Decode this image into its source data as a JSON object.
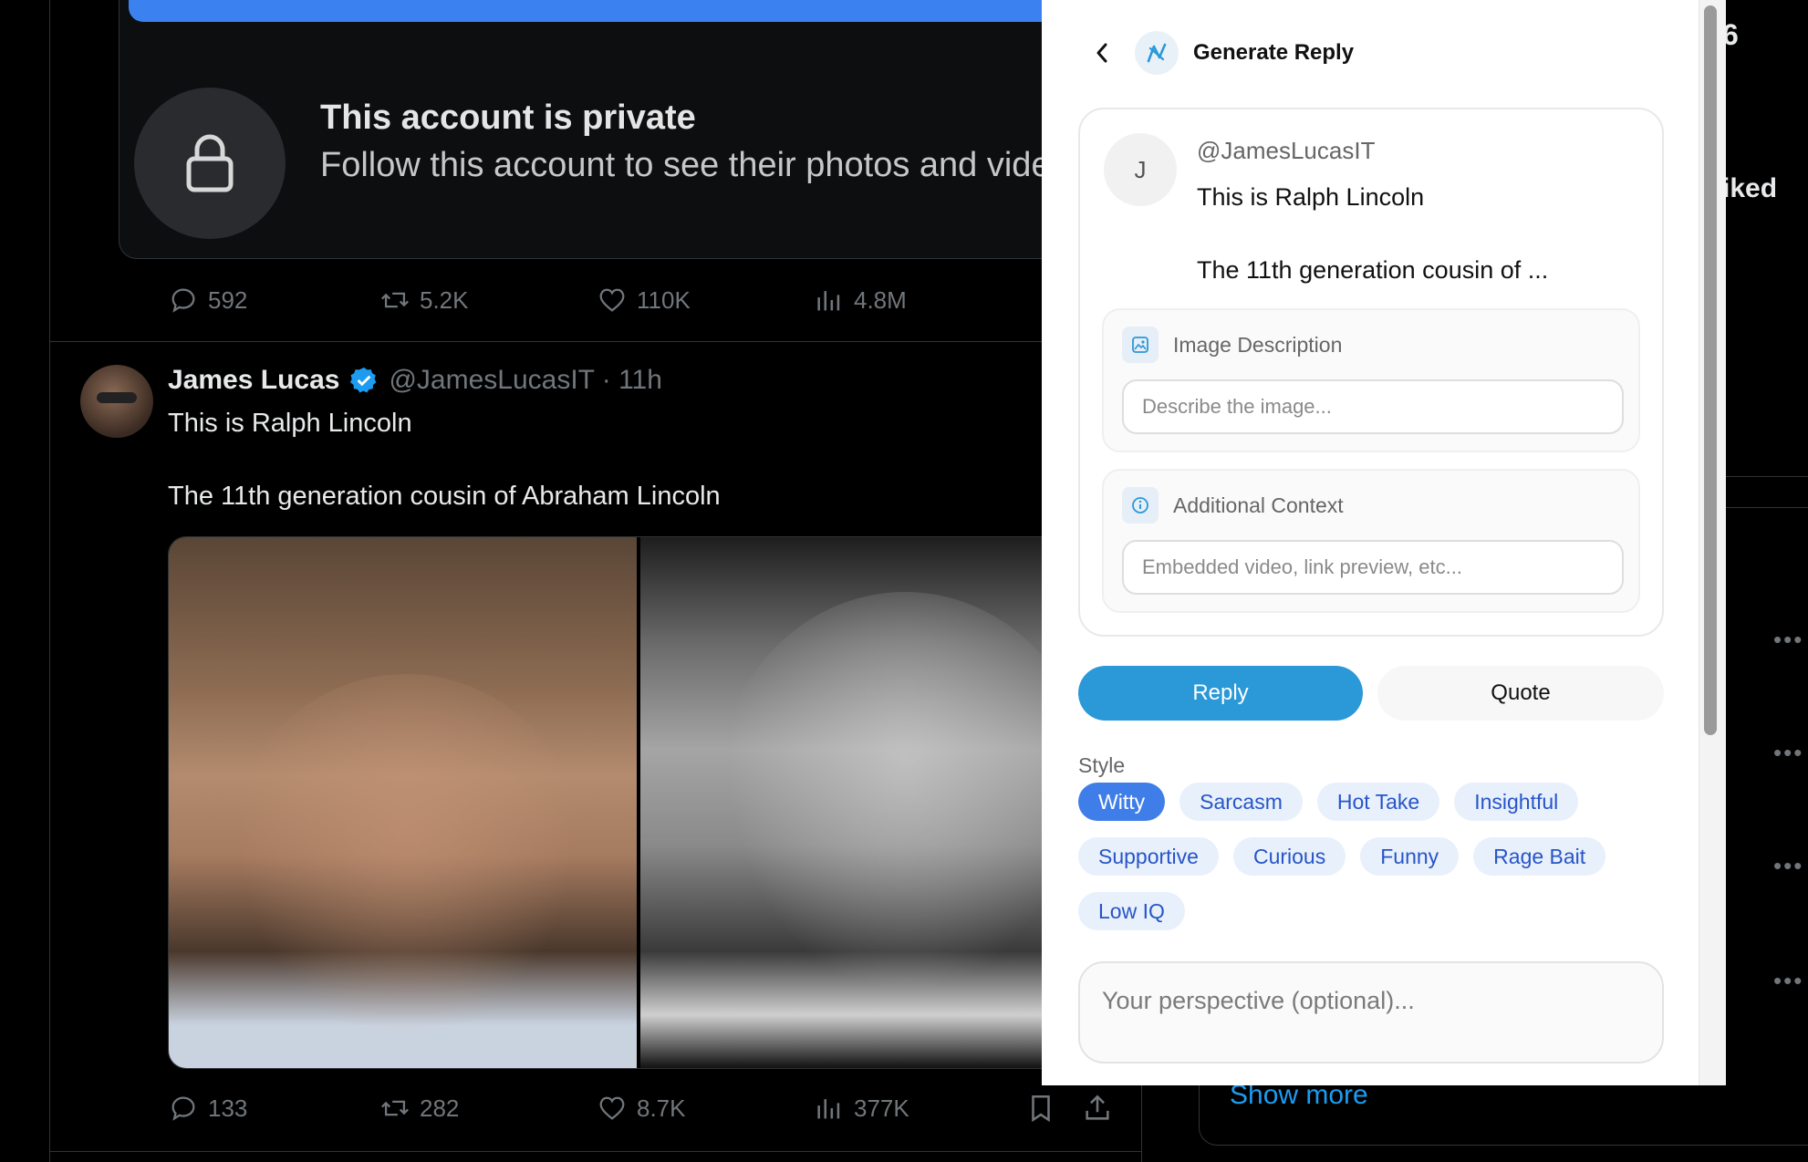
{
  "feed": {
    "private_card": {
      "title": "This account is private",
      "subtitle": "Follow this account to see their photos and videos."
    },
    "tweet1_actions": {
      "replies": "592",
      "retweets": "5.2K",
      "likes": "110K",
      "views": "4.8M"
    },
    "tweet2": {
      "author_name": "James Lucas",
      "author_handle": "@JamesLucasIT · 11h",
      "line1": "This is Ralph Lincoln",
      "line2": "The 11th generation cousin of Abraham Lincoln",
      "actions": {
        "replies": "133",
        "retweets": "282",
        "likes": "8.7K",
        "views": "377K"
      }
    }
  },
  "right_column": {
    "trend_fragment": "6",
    "liked_fragment": "iked",
    "show_more": "Show more"
  },
  "panel": {
    "title": "Generate Reply",
    "tweet_preview": {
      "avatar_letter": "J",
      "handle": "@JamesLucasIT",
      "line1": "This is Ralph Lincoln",
      "line2": "The 11th generation cousin of ..."
    },
    "image_description": {
      "label": "Image Description",
      "placeholder": "Describe the image...",
      "value": ""
    },
    "additional_context": {
      "label": "Additional Context",
      "placeholder": "Embedded video, link preview, etc...",
      "value": ""
    },
    "modes": {
      "reply": "Reply",
      "quote": "Quote",
      "selected": "Reply"
    },
    "style_label": "Style",
    "styles": [
      "Witty",
      "Sarcasm",
      "Hot Take",
      "Insightful",
      "Supportive",
      "Curious",
      "Funny",
      "Rage Bait",
      "Low IQ"
    ],
    "selected_style": "Witty",
    "perspective_placeholder": "Your perspective (optional)...",
    "colors": {
      "accent": "#2b98d8",
      "chip_active": "#3f7ee8",
      "chip_bg": "#e8f0fc",
      "chip_text": "#2755c8"
    }
  }
}
